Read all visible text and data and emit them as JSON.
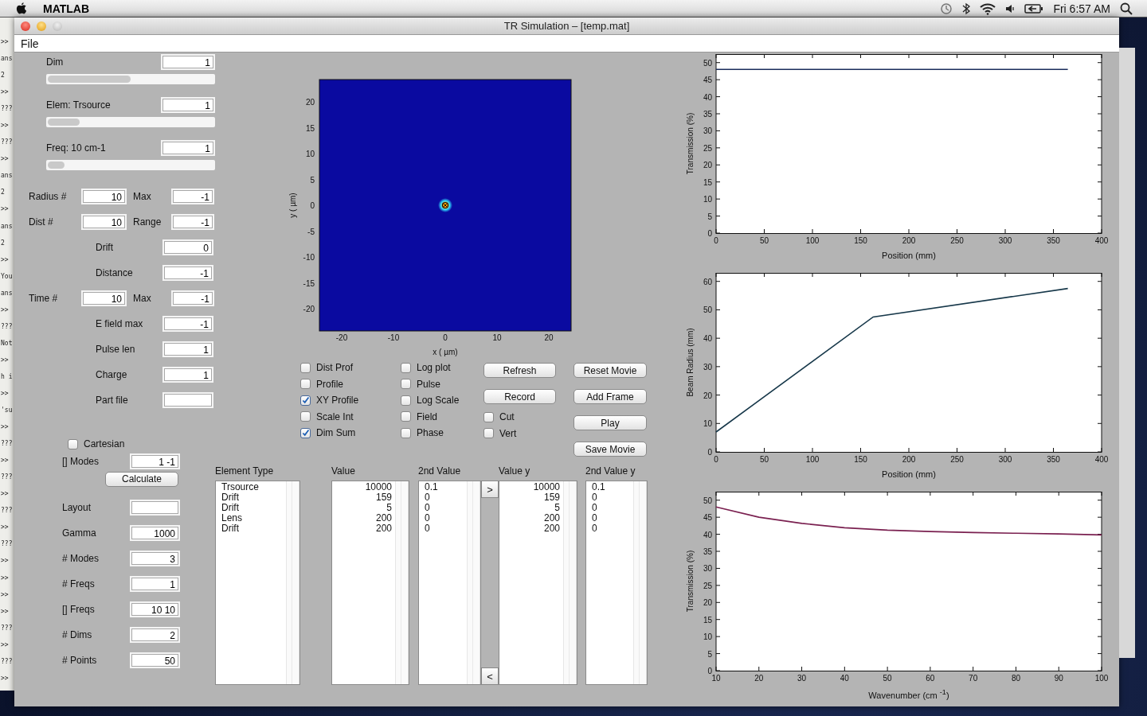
{
  "menubar": {
    "app": "MATLAB",
    "clock": "Fri 6:57 AM"
  },
  "console_lines": [
    ">>",
    "ans",
    "2",
    ">>",
    "???",
    ">>",
    "???",
    ">>",
    "ans",
    "2",
    ">>",
    "ans",
    "2",
    ">>",
    "You",
    "ans",
    ">>",
    "???",
    "Not",
    ">>",
    "h i",
    ">>",
    "'su",
    ">>",
    "???",
    ">>",
    "???",
    ">>",
    "???",
    ">>",
    "???",
    ">>",
    ">>",
    ">>",
    ">>",
    "???",
    ">>",
    "???",
    ">>"
  ],
  "window": {
    "title": "TR Simulation – [temp.mat]",
    "menu": [
      "File"
    ]
  },
  "sliders": [
    {
      "label": "Dim",
      "value": "1",
      "level": 0.5
    },
    {
      "label": "Elem: Trsource",
      "value": "1",
      "level": 0.19
    },
    {
      "label": "Freq: 10 cm-1",
      "value": "1",
      "level": 0.1
    }
  ],
  "params": [
    {
      "kind": "pair",
      "label": "Radius #",
      "value": "10",
      "label2": "Max",
      "value2": "-1"
    },
    {
      "kind": "pair",
      "label": "Dist #",
      "value": "10",
      "label2": "Range",
      "value2": "-1"
    },
    {
      "kind": "single",
      "label": "Drift",
      "value": "0"
    },
    {
      "kind": "single",
      "label": "Distance",
      "value": "-1"
    },
    {
      "kind": "pair",
      "label": "Time #",
      "value": "10",
      "label2": "Max",
      "value2": "-1"
    },
    {
      "kind": "single",
      "label": "E field max",
      "value": "-1"
    },
    {
      "kind": "single",
      "label": "Pulse len",
      "value": "1"
    },
    {
      "kind": "single",
      "label": "Charge",
      "value": "1"
    },
    {
      "kind": "single",
      "label": "Part file"
    }
  ],
  "options": [
    {
      "kind": "checkbox",
      "label": "Cartesian",
      "checked": false
    },
    {
      "kind": "field",
      "label": "[] Modes",
      "value": "1 -1"
    },
    {
      "kind": "button",
      "label": "Calculate"
    },
    {
      "kind": "field",
      "label": "Layout"
    },
    {
      "kind": "field",
      "label": "Gamma",
      "value": "1000"
    },
    {
      "kind": "field",
      "label": "# Modes",
      "value": "3"
    },
    {
      "kind": "field",
      "label": "# Freqs",
      "value": "1"
    },
    {
      "kind": "field",
      "label": "[] Freqs",
      "value": "10 10"
    },
    {
      "kind": "field",
      "label": "# Dims",
      "value": "2"
    },
    {
      "kind": "field",
      "label": "# Points",
      "value": "50"
    }
  ],
  "image_plot": {
    "xlabel": "x ( µm)",
    "ylabel": "y ( µm)",
    "xticks": [
      "-20",
      "-10",
      "0",
      "10",
      "20"
    ],
    "yticks": [
      "20",
      "15",
      "10",
      "5",
      "0",
      "-5",
      "-10",
      "-15",
      "-20"
    ]
  },
  "controls": [
    [
      {
        "kind": "checkbox",
        "label": "Dist Prof",
        "checked": false
      },
      {
        "kind": "checkbox",
        "label": "Profile",
        "checked": false
      },
      {
        "kind": "checkbox",
        "label": "XY Profile",
        "checked": true
      },
      {
        "kind": "checkbox",
        "label": "Scale Int",
        "checked": false
      },
      {
        "kind": "checkbox",
        "label": "Dim Sum",
        "checked": true
      }
    ],
    [
      {
        "kind": "checkbox",
        "label": "Log plot",
        "checked": false
      },
      {
        "kind": "checkbox",
        "label": "Pulse",
        "checked": false
      },
      {
        "kind": "checkbox",
        "label": "Log Scale",
        "checked": false
      },
      {
        "kind": "checkbox",
        "label": "Field",
        "checked": false
      },
      {
        "kind": "checkbox",
        "label": "Phase",
        "checked": false
      }
    ],
    [
      {
        "kind": "button",
        "label": "Refresh"
      },
      {
        "kind": "button",
        "label": "Record"
      },
      {
        "kind": "checkbox",
        "label": "Cut",
        "checked": false
      },
      {
        "kind": "checkbox",
        "label": "Vert",
        "checked": false
      }
    ],
    [
      {
        "kind": "button",
        "label": "Reset Movie"
      },
      {
        "kind": "button",
        "label": "Add Frame"
      },
      {
        "kind": "button",
        "label": "Play"
      },
      {
        "kind": "button",
        "label": "Save Movie"
      }
    ]
  ],
  "lists": [
    {
      "header": "Element Type",
      "kind": "text",
      "items": [
        "Trsource",
        "Drift",
        "Drift",
        "Lens",
        "Drift"
      ]
    },
    {
      "header": "Value",
      "kind": "number",
      "items": [
        "10000",
        "159",
        "5",
        "200",
        "200"
      ]
    },
    {
      "header": "2nd Value",
      "kind": "text",
      "items": [
        "0.1",
        "0",
        "0",
        "0",
        "0"
      ]
    },
    {
      "header": "Value y",
      "kind": "number",
      "items": [
        "10000",
        "159",
        "5",
        "200",
        "200"
      ]
    },
    {
      "header": "2nd Value y",
      "kind": "text",
      "items": [
        "0.1",
        "0",
        "0",
        "0",
        "0"
      ]
    }
  ],
  "arrow_buttons": [
    ">",
    "<"
  ],
  "charts": [
    {
      "chart_data": {
        "type": "line",
        "xlabel": "Position (mm)",
        "ylabel": "Transmission (%)",
        "xlim": [
          0,
          400
        ],
        "ylim": [
          0,
          52.5
        ],
        "xticks": [
          0,
          50,
          100,
          150,
          200,
          250,
          300,
          350,
          400
        ],
        "yticks": [
          0,
          5,
          10,
          15,
          20,
          25,
          30,
          35,
          40,
          45,
          50
        ],
        "x": [
          0,
          365
        ],
        "series": [
          {
            "color": "#1b2d5c",
            "values": [
              48,
              48
            ]
          }
        ]
      }
    },
    {
      "chart_data": {
        "type": "line",
        "xlabel": "Position (mm)",
        "ylabel": "Beam Radius (mm)",
        "xlim": [
          0,
          400
        ],
        "ylim": [
          0,
          63
        ],
        "xticks": [
          0,
          50,
          100,
          150,
          200,
          250,
          300,
          350,
          400
        ],
        "yticks": [
          0,
          10,
          20,
          30,
          40,
          50,
          60
        ],
        "x": [
          0,
          163,
          365
        ],
        "series": [
          {
            "color": "#17384a",
            "values": [
              7,
              47.5,
              57.5
            ]
          }
        ]
      }
    },
    {
      "chart_data": {
        "type": "line",
        "xlabel": "Wavenumber (cm $^{-1}$)",
        "ylabel": "Transmission (%)",
        "xlim": [
          10,
          100
        ],
        "ylim": [
          0,
          52.5
        ],
        "xticks": [
          10,
          20,
          30,
          40,
          50,
          60,
          70,
          80,
          90,
          100
        ],
        "yticks": [
          0,
          5,
          10,
          15,
          20,
          25,
          30,
          35,
          40,
          45,
          50
        ],
        "x": [
          10,
          20,
          30,
          40,
          50,
          60,
          70,
          80,
          90,
          100
        ],
        "series": [
          {
            "color": "#7a2050",
            "values": [
              48,
              45,
              43.2,
              41.9,
              41.2,
              40.8,
              40.5,
              40.3,
              40.1,
              39.8
            ]
          }
        ]
      }
    }
  ]
}
